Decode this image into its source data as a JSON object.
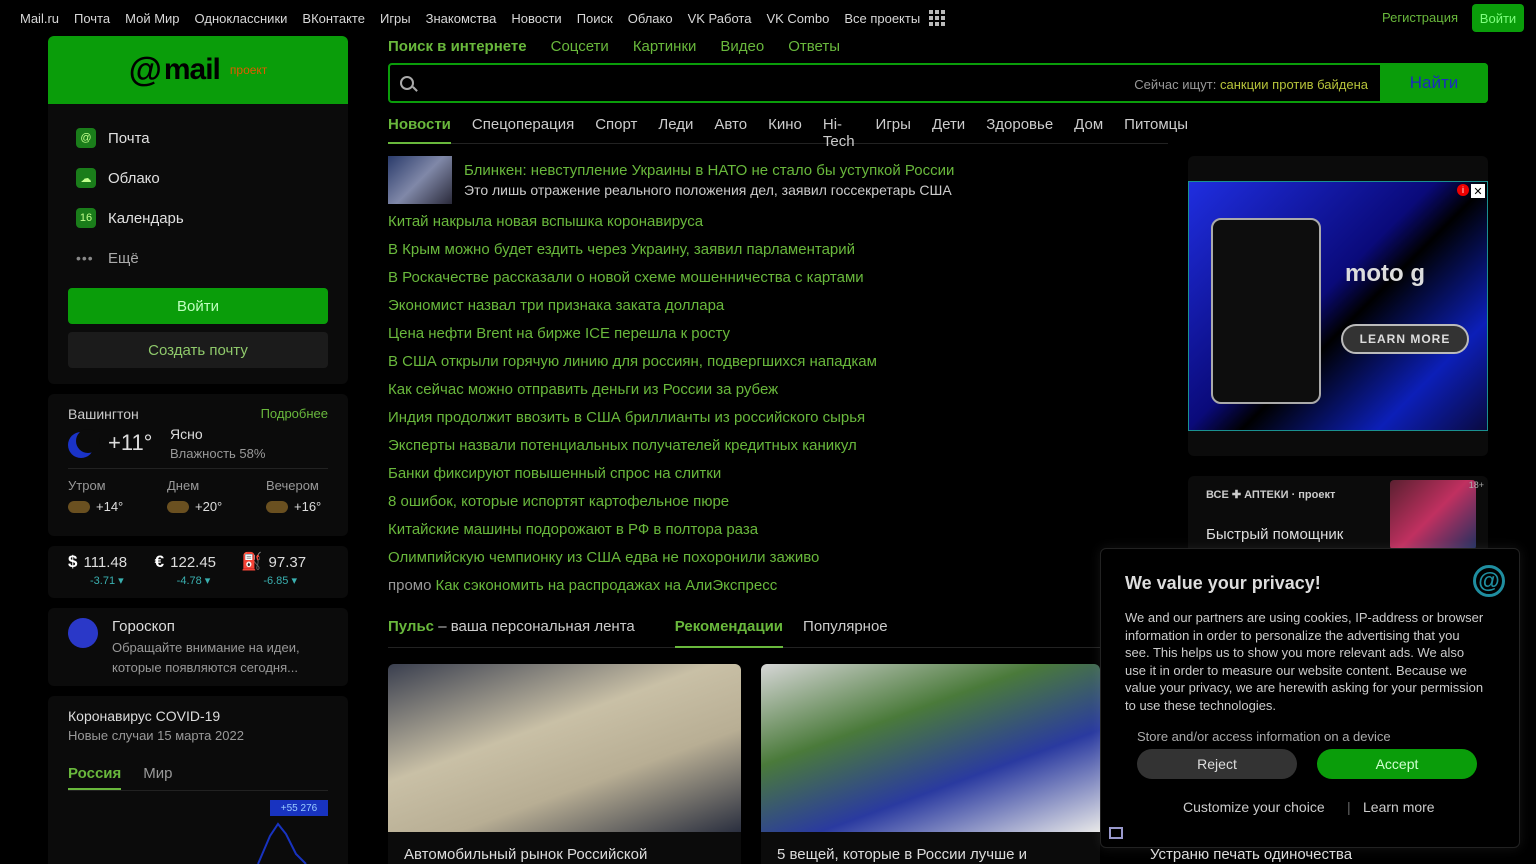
{
  "topbar": {
    "links": [
      "Mail.ru",
      "Почта",
      "Мой Мир",
      "Одноклассники",
      "ВКонтакте",
      "Игры",
      "Знакомства",
      "Новости",
      "Поиск",
      "Облако",
      "VK Работа",
      "VK Combo",
      "Все проекты"
    ],
    "register": "Регистрация",
    "login": "Войти"
  },
  "logo": {
    "at": "@",
    "mail": "mail",
    "project": "проект"
  },
  "menu": {
    "items": [
      {
        "label": "Почта",
        "icon": "mail-icon",
        "glyph": "@"
      },
      {
        "label": "Облако",
        "icon": "cloud-icon",
        "glyph": "☁"
      },
      {
        "label": "Календарь",
        "icon": "calendar-icon",
        "glyph": "16"
      }
    ],
    "more": "Ещё",
    "login_button": "Войти",
    "create_button": "Создать почту"
  },
  "weather": {
    "city": "Вашингтон",
    "more": "Подробнее",
    "temp": "+11°",
    "condition": "Ясно",
    "humidity": "Влажность 58%",
    "parts": [
      {
        "label": "Утром",
        "temp": "+14°"
      },
      {
        "label": "Днем",
        "temp": "+20°"
      },
      {
        "label": "Вечером",
        "temp": "+16°"
      }
    ]
  },
  "rates": [
    {
      "symbol": "$",
      "value": "111.48",
      "delta": "-3.71 ▾"
    },
    {
      "symbol": "€",
      "value": "122.45",
      "delta": "-4.78 ▾"
    },
    {
      "symbol": "⛽",
      "value": "97.37",
      "delta": "-6.85 ▾"
    }
  ],
  "horoscope": {
    "title": "Гороскоп",
    "text": "Обращайте внимание на идеи, которые появляются сегодня..."
  },
  "covid": {
    "title": "Коронавирус COVID-19",
    "subtitle": "Новые случаи 15 марта 2022",
    "tabs": [
      "Россия",
      "Мир"
    ],
    "badge": "+55 276"
  },
  "search": {
    "tabs": [
      "Поиск в интернете",
      "Соцсети",
      "Картинки",
      "Видео",
      "Ответы"
    ],
    "placeholder": "",
    "hint_prefix": "Сейчас ищут:",
    "hint_query": "санкции против байдена",
    "button": "Найти"
  },
  "news_tabs": [
    "Новости",
    "Спецоперация",
    "Спорт",
    "Леди",
    "Авто",
    "Кино",
    "Hi-Tech",
    "Игры",
    "Дети",
    "Здоровье",
    "Дом",
    "Питомцы"
  ],
  "top_news": {
    "title": "Блинкен: невступление Украины в НАТО не стало бы уступкой России",
    "desc": "Это лишь отражение реального положения дел, заявил госсекретарь США"
  },
  "news": [
    "Китай накрыла новая вспышка коронавируса",
    "В Крым можно будет ездить через Украину, заявил парламентарий",
    "В Роскачестве рассказали о новой схеме мошенничества с картами",
    "Экономист назвал три признака заката доллара",
    "Цена нефти Brent на бирже ICE перешла к росту",
    "В США открыли горячую линию для россиян, подвергшихся нападкам",
    "Как сейчас можно отправить деньги из России за рубеж",
    "Индия продолжит ввозить в США бриллианты из российского сырья",
    "Эксперты назвали потенциальных получателей кредитных каникул",
    "Банки фиксируют повышенный спрос на слитки",
    "8 ошибок, которые испортят картофельное пюре",
    "Китайские машины подорожают в РФ в полтора раза",
    "Олимпийскую чемпионку из США едва не похоронили заживо"
  ],
  "promo": {
    "tag": "промо",
    "text": "Как сэкономить на распродажах на АлиЭкспресс"
  },
  "pulse": {
    "title": "Пульс",
    "subtitle": " – ваша персональная лента",
    "rec": "Рекомендации",
    "popular": "Популярное",
    "cards": [
      "Автомобильный рынок Российской",
      "5 вещей, которые в России лучше и",
      "Устраню печать одиночества"
    ]
  },
  "ad": {
    "brand": "moto g",
    "cta": "LEARN MORE",
    "close": "✕",
    "info": "i"
  },
  "ad2": {
    "label": "ВСЕ ✚ АПТЕКИ · проект",
    "text": "Быстрый помощник",
    "age": "18+"
  },
  "cookie": {
    "title": "We value your privacy!",
    "body": "We and our partners are using cookies, IP-address or browser information in order to personalize the advertising that you see. This helps us to show you more relevant ads. We also use it in order to measure our website content. Because we value your privacy, we are herewith asking for your permission to use these technologies.",
    "store": "Store and/or access information on a device",
    "reject": "Reject",
    "accept": "Accept",
    "customize": "Customize your choice",
    "divider": "|",
    "learn": "Learn more"
  }
}
